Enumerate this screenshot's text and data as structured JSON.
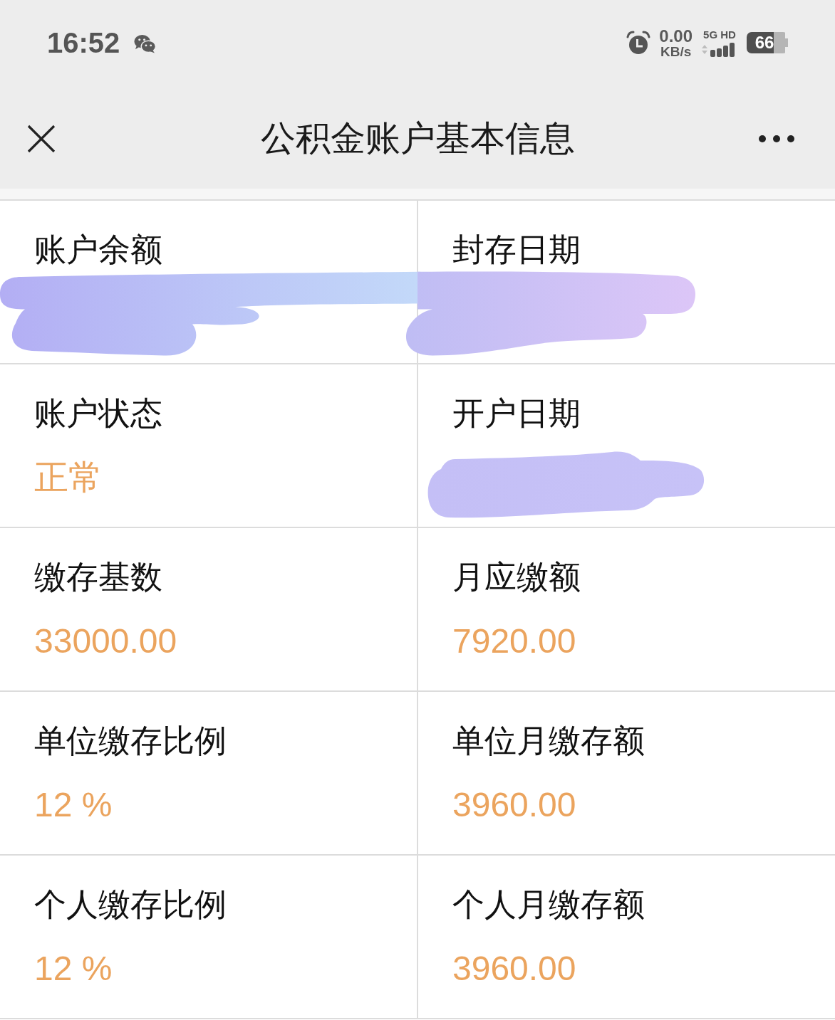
{
  "status_bar": {
    "time": "16:52",
    "net_speed": "0.00",
    "net_speed_unit": "KB/s",
    "network": "5G HD",
    "battery": "66"
  },
  "header": {
    "title": "公积金账户基本信息"
  },
  "rows": [
    {
      "cells": [
        {
          "label": "账户余额",
          "redacted": true
        },
        {
          "label": "封存日期",
          "redacted": true
        }
      ]
    },
    {
      "cells": [
        {
          "label": "账户状态",
          "value": "正常",
          "redacted": false
        },
        {
          "label": "开户日期",
          "redacted": true
        }
      ]
    },
    {
      "cells": [
        {
          "label": "缴存基数",
          "value": "33000.00",
          "redacted": false
        },
        {
          "label": "月应缴额",
          "value": "7920.00",
          "redacted": false
        }
      ]
    },
    {
      "cells": [
        {
          "label": "单位缴存比例",
          "value": "12 %",
          "redacted": false
        },
        {
          "label": "单位月缴存额",
          "value": "3960.00",
          "redacted": false
        }
      ]
    },
    {
      "cells": [
        {
          "label": "个人缴存比例",
          "value": "12 %",
          "redacted": false
        },
        {
          "label": "个人月缴存额",
          "value": "3960.00",
          "redacted": false
        }
      ]
    }
  ]
}
